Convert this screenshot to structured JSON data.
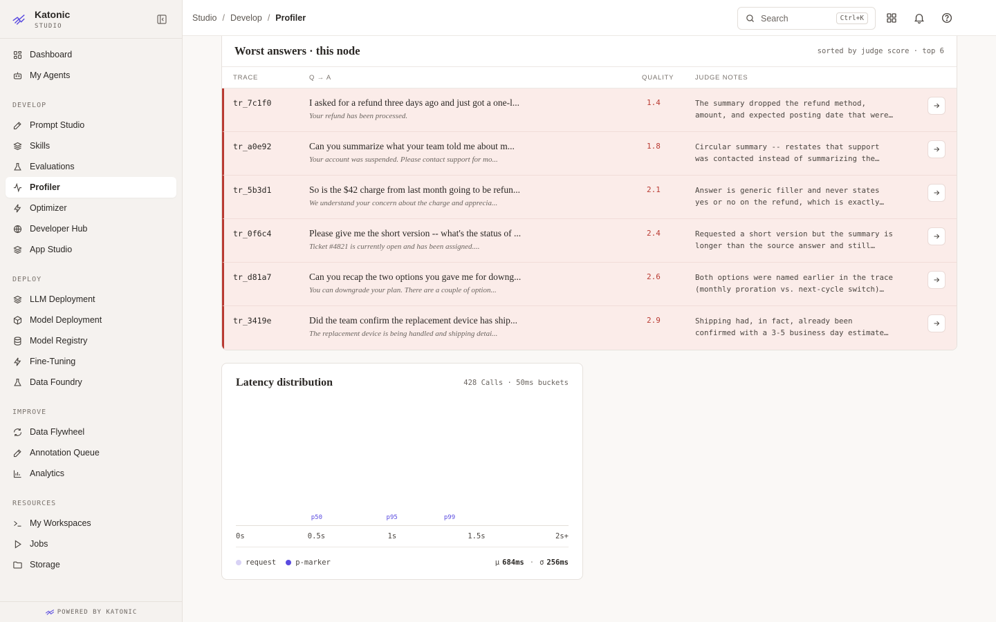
{
  "brand": {
    "name": "Katonic",
    "sub": "STUDIO"
  },
  "colors": {
    "accent": "#5a4be0",
    "danger": "#b93a32",
    "row_bg": "#fbece9"
  },
  "nav": {
    "top": [
      {
        "label": "Dashboard",
        "icon": "grid-icon"
      },
      {
        "label": "My Agents",
        "icon": "robot-icon"
      }
    ],
    "develop_title": "DEVELOP",
    "develop": [
      {
        "label": "Prompt Studio",
        "icon": "edit-icon"
      },
      {
        "label": "Skills",
        "icon": "layers-icon"
      },
      {
        "label": "Evaluations",
        "icon": "flask-icon"
      },
      {
        "label": "Profiler",
        "icon": "activity-icon",
        "active": true
      },
      {
        "label": "Optimizer",
        "icon": "bolt-icon"
      },
      {
        "label": "Developer Hub",
        "icon": "globe-icon"
      },
      {
        "label": "App Studio",
        "icon": "layers-icon"
      }
    ],
    "deploy_title": "DEPLOY",
    "deploy": [
      {
        "label": "LLM Deployment",
        "icon": "layers-icon"
      },
      {
        "label": "Model Deployment",
        "icon": "cube-icon"
      },
      {
        "label": "Model Registry",
        "icon": "database-icon"
      },
      {
        "label": "Fine-Tuning",
        "icon": "bolt-icon"
      },
      {
        "label": "Data Foundry",
        "icon": "flask-icon"
      }
    ],
    "improve_title": "IMPROVE",
    "improve": [
      {
        "label": "Data Flywheel",
        "icon": "refresh-icon"
      },
      {
        "label": "Annotation Queue",
        "icon": "edit-icon"
      },
      {
        "label": "Analytics",
        "icon": "bar-chart-icon"
      }
    ],
    "resources_title": "RESOURCES",
    "resources": [
      {
        "label": "My Workspaces",
        "icon": "terminal-icon"
      },
      {
        "label": "Jobs",
        "icon": "play-icon"
      },
      {
        "label": "Storage",
        "icon": "folder-icon"
      }
    ]
  },
  "footer": "POWERED BY KATONIC",
  "breadcrumb": [
    "Studio",
    "Develop",
    "Profiler"
  ],
  "search": {
    "placeholder": "Search",
    "shortcut": "Ctrl+K"
  },
  "worst": {
    "title": "Worst answers · this node",
    "meta": "sorted by judge score · top 6",
    "columns": {
      "trace": "TRACE",
      "qa": "Q → A",
      "quality": "QUALITY",
      "notes": "JUDGE NOTES"
    },
    "rows": [
      {
        "trace": "tr_7c1f0",
        "q": "I asked for a refund three days ago and just got a one-l...",
        "a": "Your refund has been processed.",
        "score": "1.4",
        "note1": "The summary dropped the refund method,",
        "note2": "amount, and expected posting date that were…"
      },
      {
        "trace": "tr_a0e92",
        "q": "Can you summarize what your team told me about m...",
        "a": "Your account was suspended. Please contact support for mo...",
        "score": "1.8",
        "note1": "Circular summary -- restates that support",
        "note2": "was contacted instead of summarizing the…"
      },
      {
        "trace": "tr_5b3d1",
        "q": "So is the $42 charge from last month going to be refun...",
        "a": "We understand your concern about the charge and apprecia...",
        "score": "2.1",
        "note1": "Answer is generic filler and never states",
        "note2": "yes or no on the refund, which is exactly…"
      },
      {
        "trace": "tr_0f6c4",
        "q": "Please give me the short version -- what's the status of ...",
        "a": "Ticket #4821 is currently open and has been assigned....",
        "score": "2.4",
        "note1": "Requested a short version but the summary is",
        "note2": "longer than the source answer and still…"
      },
      {
        "trace": "tr_d81a7",
        "q": "Can you recap the two options you gave me for downg...",
        "a": "You can downgrade your plan. There are a couple of option...",
        "score": "2.6",
        "note1": "Both options were named earlier in the trace",
        "note2": "(monthly proration vs. next-cycle switch)…"
      },
      {
        "trace": "tr_3419e",
        "q": "Did the team confirm the replacement device has ship...",
        "a": "The replacement device is being handled and shipping detai...",
        "score": "2.9",
        "note1": "Shipping had, in fact, already been",
        "note2": "confirmed with a 3-5 business day estimate…"
      }
    ]
  },
  "latency": {
    "title": "Latency distribution",
    "meta": "428 Calls · 50ms buckets",
    "legend_request": "request",
    "legend_marker": "p-marker",
    "mu_label": "μ",
    "mu": "684ms",
    "sigma_label": "σ",
    "sigma": "256ms"
  },
  "chart_data": {
    "type": "bar",
    "x_ticks": [
      "0s",
      "0.5s",
      "1s",
      "1.5s",
      "2s+"
    ],
    "x_range": [
      0,
      2.0
    ],
    "markers": [
      {
        "name": "p50",
        "x": 0.5
      },
      {
        "name": "p95",
        "x": 0.97
      },
      {
        "name": "p99",
        "x": 1.33
      }
    ],
    "values": [],
    "legend_placement": "bottom-left"
  }
}
